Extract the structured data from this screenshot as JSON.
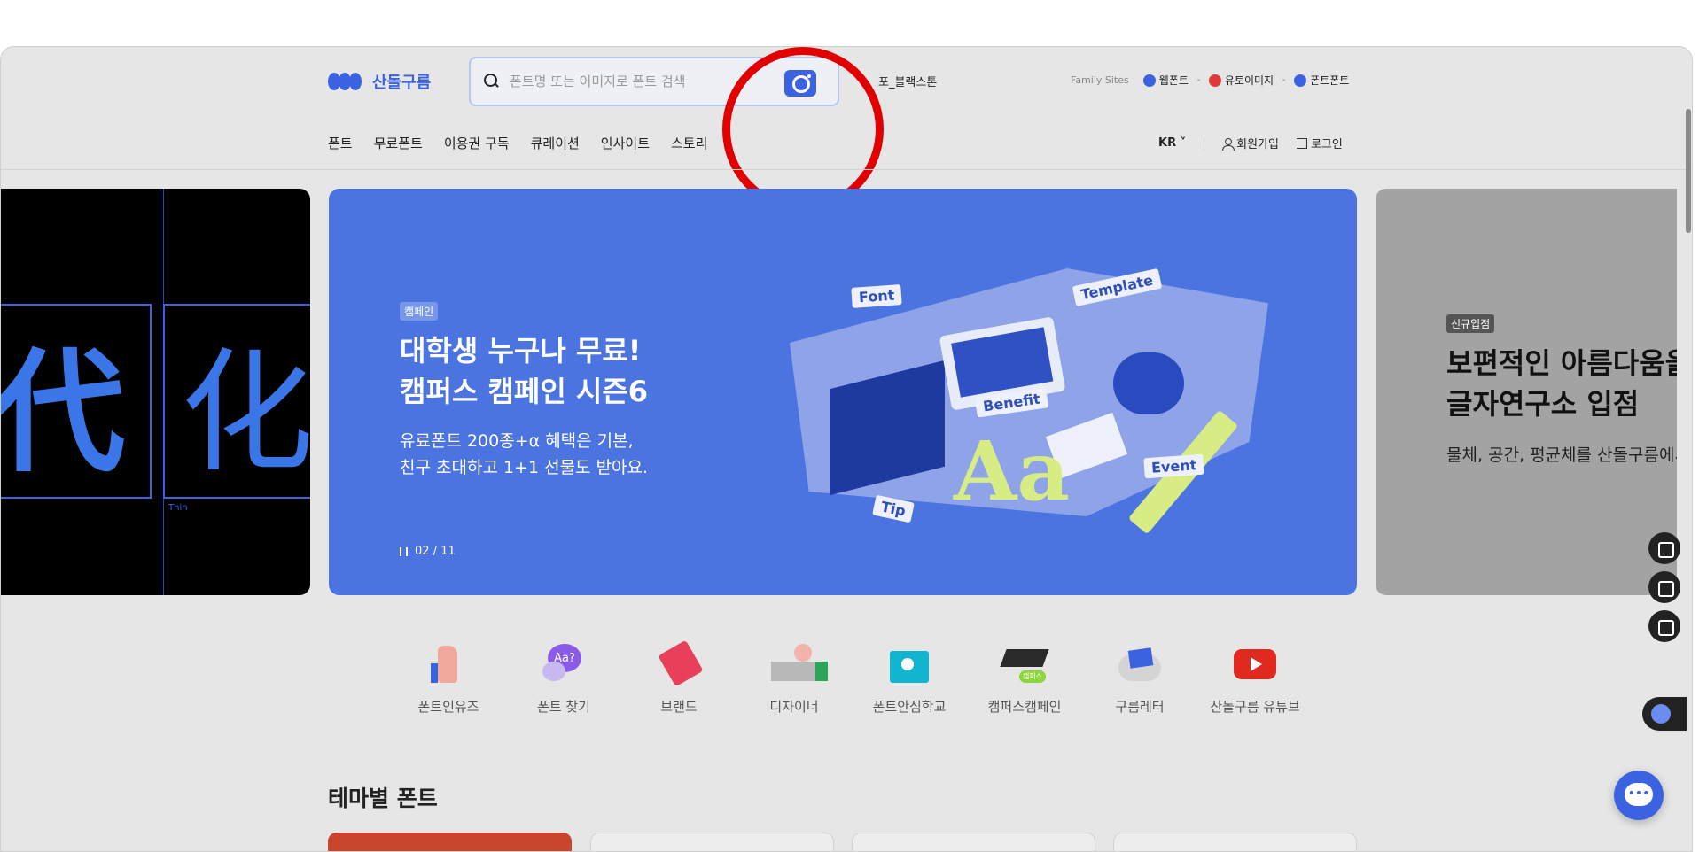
{
  "header": {
    "logo_text": "산돌구름",
    "search_placeholder": "폰트명 또는 이미지로 폰트 검색",
    "search_hint": "포_블랙스톤",
    "family_label": "Family Sites",
    "family_sites": [
      {
        "label": "웹폰트",
        "color": "#3b62e0"
      },
      {
        "label": "유토이미지",
        "color": "#e03a3a"
      },
      {
        "label": "폰트폰트",
        "color": "#3b62e0"
      }
    ]
  },
  "nav": {
    "items": [
      "폰트",
      "무료폰트",
      "이용권 구독",
      "큐레이션",
      "인사이트",
      "스토리"
    ],
    "lang": "KR",
    "signup": "회원가입",
    "login": "로그인"
  },
  "carousel": {
    "left": {
      "chars": [
        "代",
        "化"
      ],
      "label": "Thin"
    },
    "main": {
      "tag": "캠페인",
      "title_line1": "대학생 누구나 무료!",
      "title_line2": "캠퍼스 캠페인 시즌6",
      "desc_line1": "유료폰트 200종+α 혜택은 기본,",
      "desc_line2": "친구 초대하고 1+1 선물도 받아요.",
      "pager": "02 / 11",
      "stickers": [
        "Font",
        "Template",
        "Benefit",
        "Event",
        "Tip"
      ],
      "aa_text": "Aa"
    },
    "right": {
      "tag": "신규입점",
      "title_line1": "보편적인 아름다움을",
      "title_line2": "글자연구소 입점",
      "desc": "물체, 공간, 평균체를 산돌구름에서"
    }
  },
  "quick_links": [
    {
      "label": "폰트인유즈",
      "icon": "thumbs-up-icon"
    },
    {
      "label": "폰트 찾기",
      "icon": "speech-bubble-icon"
    },
    {
      "label": "브랜드",
      "icon": "tag-icon"
    },
    {
      "label": "디자이너",
      "icon": "designer-icon"
    },
    {
      "label": "폰트안심학교",
      "icon": "school-icon"
    },
    {
      "label": "캠퍼스캠페인",
      "icon": "graduation-cap-icon"
    },
    {
      "label": "구름레터",
      "icon": "cloud-letter-icon"
    },
    {
      "label": "산돌구름 유튜브",
      "icon": "youtube-icon"
    }
  ],
  "section": {
    "title": "테마별 폰트"
  }
}
